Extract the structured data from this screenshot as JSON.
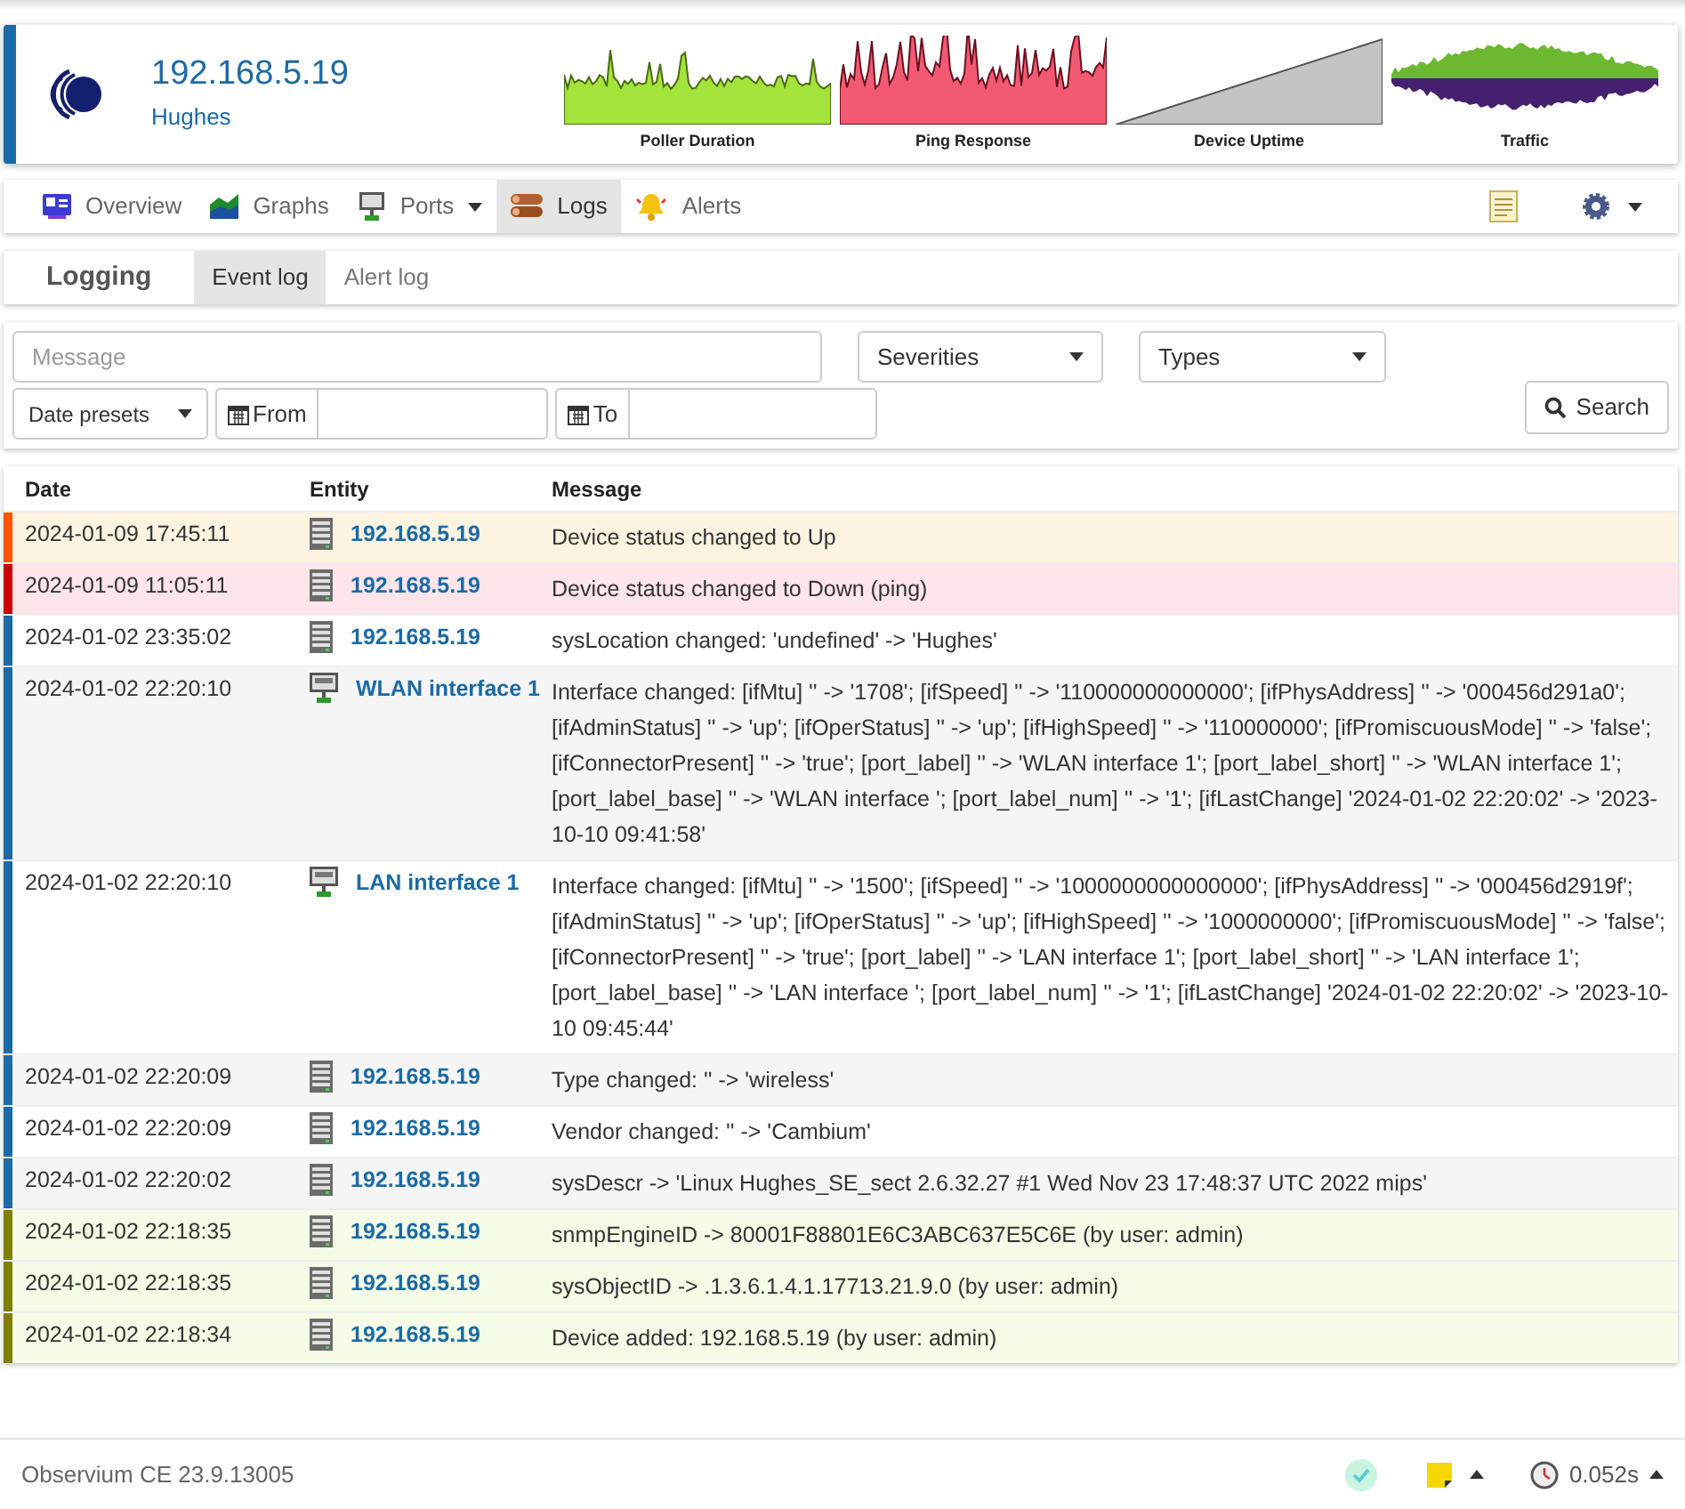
{
  "device": {
    "hostname": "192.168.5.19",
    "location": "Hughes"
  },
  "graphs": [
    {
      "title": "Poller Duration",
      "kind": "poller"
    },
    {
      "title": "Ping Response",
      "kind": "ping"
    },
    {
      "title": "Device Uptime",
      "kind": "uptime"
    },
    {
      "title": "Traffic",
      "kind": "traffic"
    }
  ],
  "nav": [
    {
      "label": "Overview",
      "kind": "overview",
      "selected": false,
      "dropdown": false
    },
    {
      "label": "Graphs",
      "kind": "graphs",
      "selected": false,
      "dropdown": false
    },
    {
      "label": "Ports",
      "kind": "ports",
      "selected": false,
      "dropdown": true
    },
    {
      "label": "Logs",
      "kind": "logs",
      "selected": true,
      "dropdown": false
    },
    {
      "label": "Alerts",
      "kind": "alerts",
      "selected": false,
      "dropdown": false
    }
  ],
  "subnav": {
    "title": "Logging",
    "tabs": [
      {
        "label": "Event log",
        "selected": true
      },
      {
        "label": "Alert log",
        "selected": false
      }
    ]
  },
  "filters": {
    "message": {
      "placeholder": "Message"
    },
    "severities": "Severities",
    "types": "Types",
    "date_presets": "Date presets",
    "from": "From",
    "to": "To",
    "search": "Search"
  },
  "table": {
    "columns": [
      "Date",
      "Entity",
      "Message"
    ],
    "rows": [
      {
        "date": "2024-01-09 17:45:11",
        "entity": {
          "label": "192.168.5.19",
          "kind": "device"
        },
        "message": "Device status changed to Up",
        "kind": "up"
      },
      {
        "date": "2024-01-09 11:05:11",
        "entity": {
          "label": "192.168.5.19",
          "kind": "device"
        },
        "message": "Device status changed to Down (ping)",
        "kind": "down"
      },
      {
        "date": "2024-01-02 23:35:02",
        "entity": {
          "label": "192.168.5.19",
          "kind": "device"
        },
        "message": "sysLocation changed: 'undefined' -> 'Hughes'",
        "kind": "info"
      },
      {
        "date": "2024-01-02 22:20:10",
        "entity": {
          "label": "WLAN interface 1",
          "kind": "port"
        },
        "message": "Interface changed: [ifMtu] '' -> '1708'; [ifSpeed] '' -> '110000000000000'; [ifPhysAddress] '' -> '000456d291a0'; [ifAdminStatus] '' -> 'up'; [ifOperStatus] '' -> 'up'; [ifHighSpeed] '' -> '110000000'; [ifPromiscuousMode] '' -> 'false'; [ifConnectorPresent] '' -> 'true'; [port_label] '' -> 'WLAN interface 1'; [port_label_short] '' -> 'WLAN interface 1'; [port_label_base] '' -> 'WLAN interface '; [port_label_num] '' -> '1'; [ifLastChange] '2024-01-02 22:20:02' -> '2023-10-10 09:41:58'",
        "kind": "info"
      },
      {
        "date": "2024-01-02 22:20:10",
        "entity": {
          "label": "LAN interface 1",
          "kind": "port"
        },
        "message": "Interface changed: [ifMtu] '' -> '1500'; [ifSpeed] '' -> '1000000000000000'; [ifPhysAddress] '' -> '000456d2919f'; [ifAdminStatus] '' -> 'up'; [ifOperStatus] '' -> 'up'; [ifHighSpeed] '' -> '1000000000'; [ifPromiscuousMode] '' -> 'false'; [ifConnectorPresent] '' -> 'true'; [port_label] '' -> 'LAN interface 1'; [port_label_short] '' -> 'LAN interface 1'; [port_label_base] '' -> 'LAN interface '; [port_label_num] '' -> '1'; [ifLastChange] '2024-01-02 22:20:02' -> '2023-10-10 09:45:44'",
        "kind": "info"
      },
      {
        "date": "2024-01-02 22:20:09",
        "entity": {
          "label": "192.168.5.19",
          "kind": "device"
        },
        "message": "Type changed: '' -> 'wireless'",
        "kind": "info"
      },
      {
        "date": "2024-01-02 22:20:09",
        "entity": {
          "label": "192.168.5.19",
          "kind": "device"
        },
        "message": "Vendor changed: '' -> 'Cambium'",
        "kind": "info"
      },
      {
        "date": "2024-01-02 22:20:02",
        "entity": {
          "label": "192.168.5.19",
          "kind": "device"
        },
        "message": "sysDescr -> 'Linux Hughes_SE_sect 2.6.32.27 #1 Wed Nov 23 17:48:37 UTC 2022 mips'",
        "kind": "info"
      },
      {
        "date": "2024-01-02 22:18:35",
        "entity": {
          "label": "192.168.5.19",
          "kind": "device"
        },
        "message": "snmpEngineID -> 80001F88801E6C3ABC637E5C6E (by user: admin)",
        "kind": "notice"
      },
      {
        "date": "2024-01-02 22:18:35",
        "entity": {
          "label": "192.168.5.19",
          "kind": "device"
        },
        "message": "sysObjectID -> .1.3.6.1.4.1.17713.21.9.0 (by user: admin)",
        "kind": "notice"
      },
      {
        "date": "2024-01-02 22:18:34",
        "entity": {
          "label": "192.168.5.19",
          "kind": "device"
        },
        "message": "Device added: 192.168.5.19 (by user: admin)",
        "kind": "notice"
      }
    ]
  },
  "footer": {
    "version": "Observium CE 23.9.13005",
    "time": "0.052s"
  }
}
